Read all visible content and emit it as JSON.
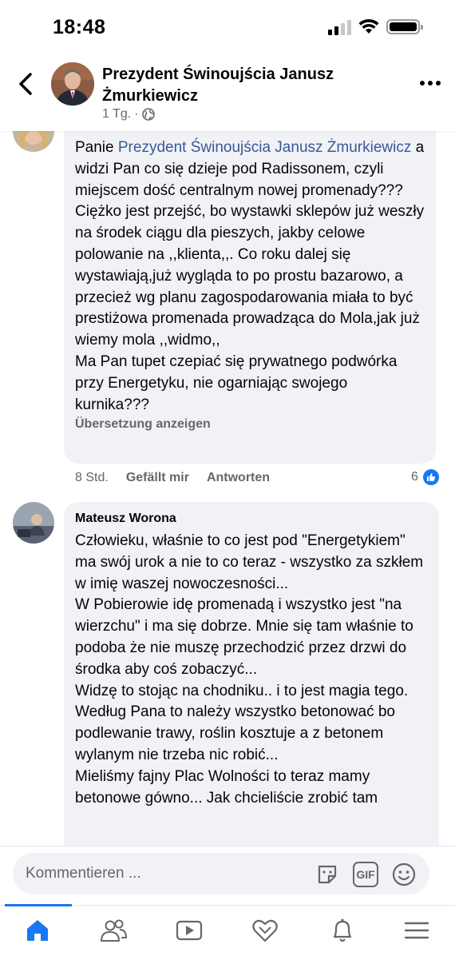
{
  "status_bar": {
    "time": "18:48"
  },
  "header": {
    "title": "Prezydent Świnoujścia Janusz Żmurkiewicz",
    "meta_time": "1 Tg.",
    "meta_separator": "·"
  },
  "comments": [
    {
      "text_prefix": "Panie ",
      "mention": "Prezydent Świnoujścia Janusz Żmurkiewicz",
      "text": " a widzi Pan co się dzieje pod Radissonem, czyli miejscem dość centralnym nowej promenady??? Ciężko jest przejść, bo wystawki sklepów już weszły na środek ciągu dla pieszych, jakby celowe polowanie na ,,klienta,,. Co roku dalej się wystawiają,już wygląda to po prostu bazarowo, a przecież wg planu zagospodarowania miała to być prestiżowa promenada prowadząca do Mola,jak już wiemy mola ,,widmo,,\nMa Pan tupet czepiać się prywatnego podwórka przy Energetyku, nie ogarniając swojego kurnika???",
      "translate_label": "Übersetzung anzeigen",
      "time": "8 Std.",
      "like_label": "Gefällt mir",
      "reply_label": "Antworten",
      "like_count": "6"
    },
    {
      "author": "Mateusz Worona",
      "text": "Człowieku, właśnie to co jest pod \"Energetykiem\" ma swój urok a nie to co teraz - wszystko za szkłem w imię waszej nowoczesności...\nW Pobierowie idę promenadą i wszystko jest \"na wierzchu\" i ma się dobrze. Mnie się tam właśnie to podoba że nie muszę przechodzić przez drzwi do środka aby coś zobaczyć...\nWidzę to stojąc na chodniku.. i to jest magia tego.\nWedług Pana to należy wszystko betonować bo podlewanie trawy, roślin kosztuje a z betonem wylanym nie trzeba nic robić...\nMieliśmy fajny Plac Wolności to teraz mamy betonowe gówno... Jak chcieliście zrobić tam"
    }
  ],
  "input": {
    "placeholder": "Kommentieren ...",
    "gif_label": "GIF"
  },
  "nav": {
    "items": [
      "home-icon",
      "friends-icon",
      "watch-icon",
      "dating-icon",
      "notifications-icon",
      "menu-icon"
    ],
    "active_color": "#1877f2"
  }
}
